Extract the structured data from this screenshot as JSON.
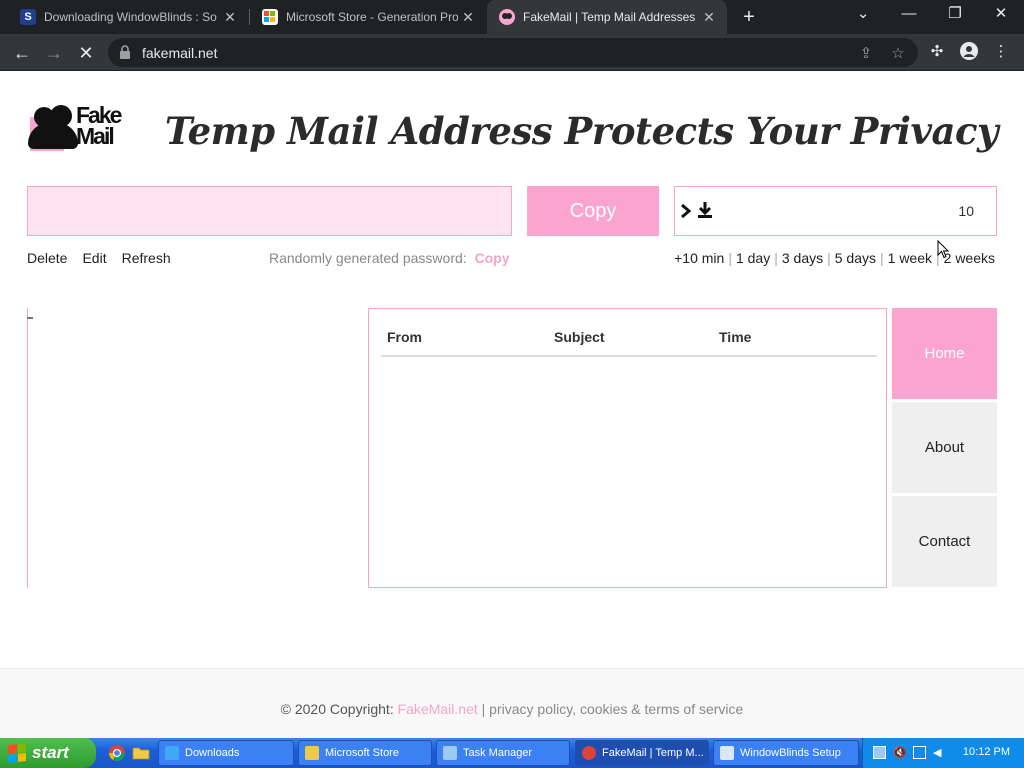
{
  "browser": {
    "tabs": [
      {
        "title": "Downloading WindowBlinds : So",
        "favicon": "stardock-icon",
        "active": false
      },
      {
        "title": "Microsoft Store - Generation Pro",
        "favicon": "store-icon",
        "active": false
      },
      {
        "title": "FakeMail | Temp Mail Addresses",
        "favicon": "fakemail-icon",
        "active": true
      }
    ],
    "url": "fakemail.net"
  },
  "site": {
    "logo_text_line1": "Fake",
    "logo_text_line2": "Mail",
    "headline": "Temp Mail Address Protects Your Privacy",
    "email_value": "",
    "copy_label": "Copy",
    "timer_count": "10",
    "actions": {
      "delete": "Delete",
      "edit": "Edit",
      "refresh": "Refresh"
    },
    "password_label": "Randomly generated password:",
    "password_copy": "Copy",
    "extend_options": [
      "+10 min",
      "1 day",
      "3 days",
      "5 days",
      "1 week",
      "2 weeks"
    ],
    "inbox_columns": {
      "from": "From",
      "subject": "Subject",
      "time": "Time"
    },
    "nav": {
      "home": "Home",
      "about": "About",
      "contact": "Contact"
    },
    "footer": {
      "copyright": "© 2020 Copyright:",
      "brand_link": "FakeMail.net",
      "separator": "|",
      "policy": "privacy policy, cookies & terms of service"
    }
  },
  "taskbar": {
    "start_label": "start",
    "tasks": [
      {
        "label": "Downloads",
        "icon": "download-folder-icon"
      },
      {
        "label": "Microsoft Store",
        "icon": "store-icon"
      },
      {
        "label": "Task Manager",
        "icon": "task-manager-icon"
      },
      {
        "label": "FakeMail | Temp M...",
        "icon": "chrome-icon"
      },
      {
        "label": "WindowBlinds Setup",
        "icon": "setup-icon"
      }
    ],
    "clock": "10:12 PM"
  },
  "colors": {
    "accent_pink": "#fba4d0",
    "input_bg": "#fde4f0",
    "chrome_dark": "#202124",
    "taskbar_blue": "#1c5fd8"
  }
}
